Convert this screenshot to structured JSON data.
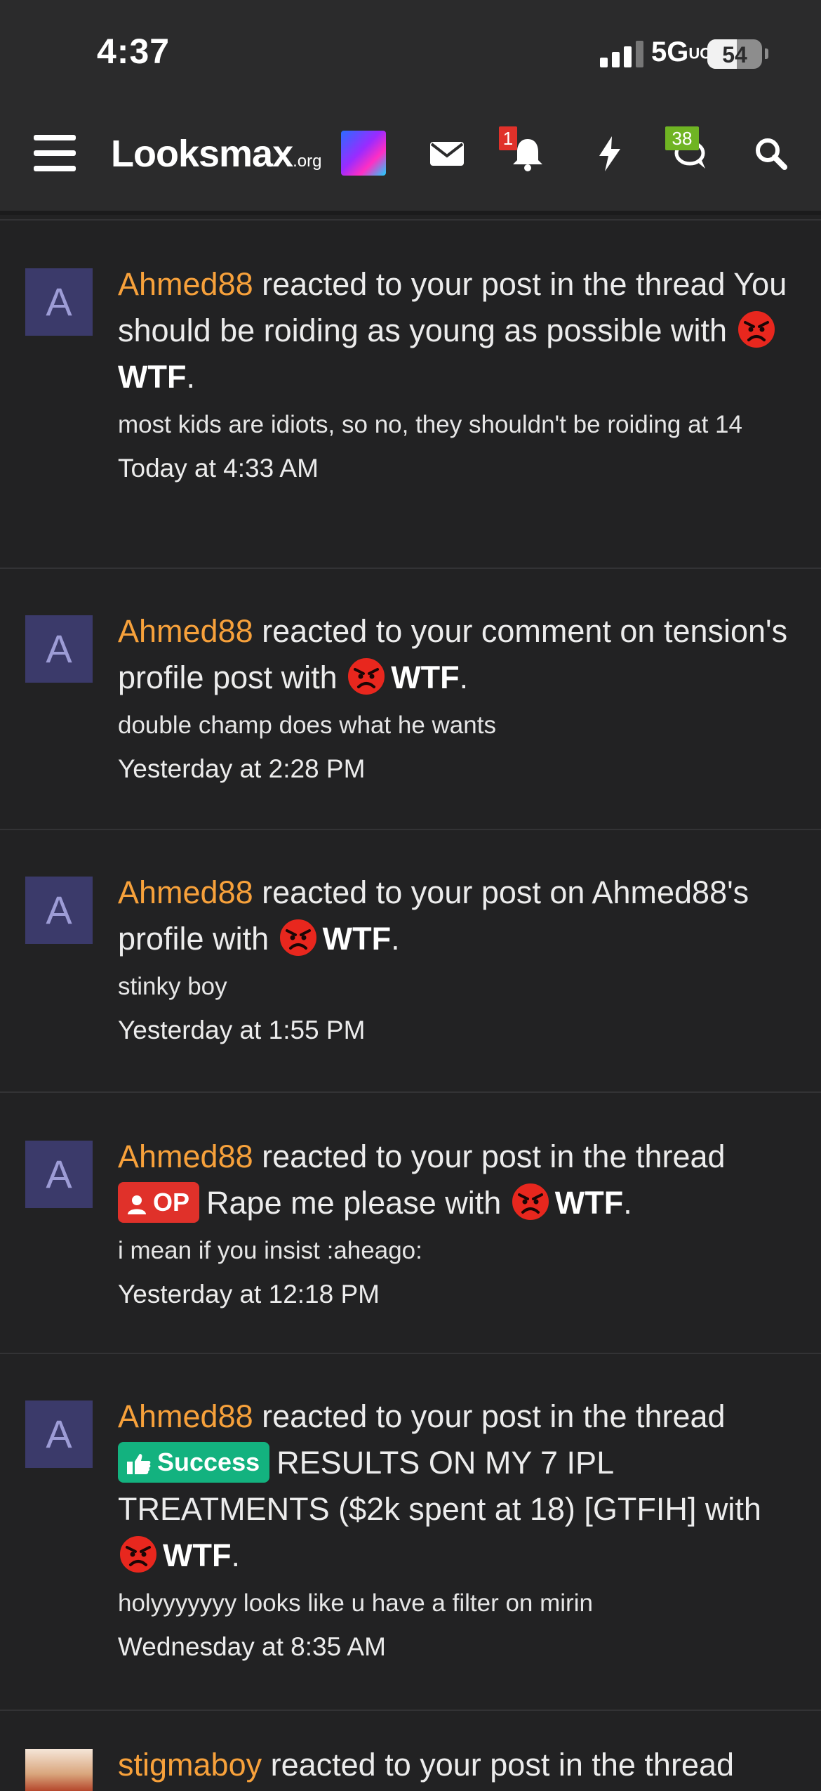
{
  "status_bar": {
    "time": "4:37",
    "network": "5G",
    "network_suffix": "UC",
    "battery": "54",
    "battery_level": 0.54
  },
  "header": {
    "logo_main": "Looksmax",
    "logo_suffix": ".org",
    "alerts_badge": "1",
    "conversations_badge": "38"
  },
  "notifications": [
    {
      "user": "Ahmed88",
      "avatar_letter": "A",
      "action": "reacted to your post in the thread",
      "target": "You should be roiding as young as possible",
      "with_text": "with",
      "reaction": "WTF",
      "snippet": "most kids are idiots, so no, they shouldn't be roiding at 14",
      "time": "Today at 4:33 AM"
    },
    {
      "user": "Ahmed88",
      "avatar_letter": "A",
      "action": "reacted to your comment on tension's profile post",
      "with_text": "with",
      "reaction": "WTF",
      "snippet": "double champ does what he wants",
      "time": "Yesterday at 2:28 PM"
    },
    {
      "user": "Ahmed88",
      "avatar_letter": "A",
      "action": "reacted to your post on Ahmed88's profile",
      "with_text": "with",
      "reaction": "WTF",
      "snippet": "stinky boy",
      "time": "Yesterday at 1:55 PM"
    },
    {
      "user": "Ahmed88",
      "avatar_letter": "A",
      "action": "reacted to your post in the thread",
      "prefix": "OP",
      "target": "Rape me please",
      "with_text": "with",
      "reaction": "WTF",
      "snippet": "i mean if you insist :aheago:",
      "time": "Yesterday at 12:18 PM"
    },
    {
      "user": "Ahmed88",
      "avatar_letter": "A",
      "action": "reacted to your post in the thread",
      "prefix": "Success",
      "target": "RESULTS ON MY 7 IPL TREATMENTS ($2k spent at 18) [GTFIH]",
      "with_text": "with",
      "reaction": "WTF",
      "snippet": "holyyyyyyy looks like u have a filter on mirin",
      "time": "Wednesday at 8:35 AM"
    },
    {
      "user": "stigmaboy",
      "action": "reacted to your post in the thread"
    }
  ],
  "colors": {
    "username": "#f7a13b",
    "op_prefix": "#e0312a",
    "success_prefix": "#13b27f",
    "avatar_bg": "#3b3a6a"
  }
}
